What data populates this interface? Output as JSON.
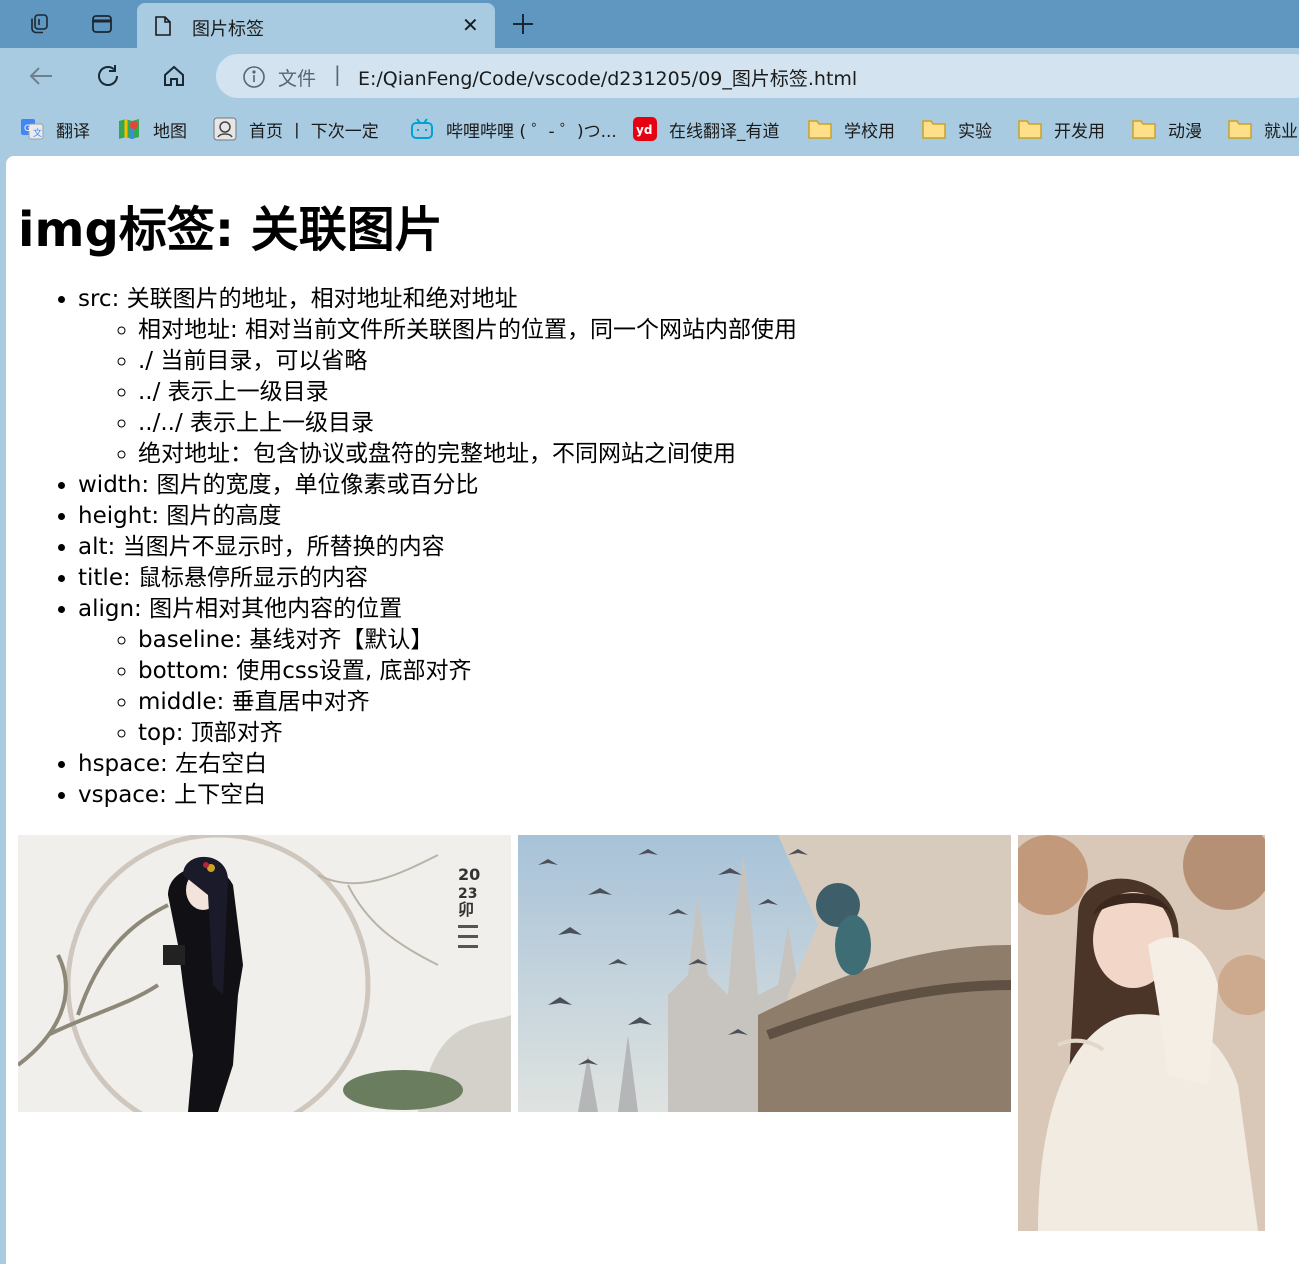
{
  "tab": {
    "title": "图片标签"
  },
  "address": {
    "scheme": "文件",
    "url": "E:/QianFeng/Code/vscode/d231205/09_图片标签.html"
  },
  "bookmarks": [
    {
      "label": "翻译",
      "icon": "google-translate-icon"
    },
    {
      "label": "地图",
      "icon": "maps-icon"
    },
    {
      "label": "首页 丨 下次一定",
      "icon": "avatar-icon"
    },
    {
      "label": "哔哩哔哩 ( ゜- ゜)つ...",
      "icon": "bilibili-icon"
    },
    {
      "label": "在线翻译_有道",
      "icon": "youdao-icon"
    },
    {
      "label": "学校用",
      "icon": "folder-icon"
    },
    {
      "label": "实验",
      "icon": "folder-icon"
    },
    {
      "label": "开发用",
      "icon": "folder-icon"
    },
    {
      "label": "动漫",
      "icon": "folder-icon"
    },
    {
      "label": "就业",
      "icon": "folder-icon"
    }
  ],
  "page": {
    "heading": "img标签: 关联图片",
    "items": {
      "src": "src: 关联图片的地址，相对地址和绝对地址",
      "src_sub": [
        "相对地址: 相对当前文件所关联图片的位置，同一个网站内部使用",
        "./ 当前目录，可以省略",
        "../ 表示上一级目录",
        "../../ 表示上上一级目录",
        "绝对地址：包含协议或盘符的完整地址，不同网站之间使用"
      ],
      "width": "width: 图片的宽度，单位像素或百分比",
      "height": "height: 图片的高度",
      "alt": "alt: 当图片不显示时，所替换的内容",
      "title": "title: 鼠标悬停所显示的内容",
      "align": "align: 图片相对其他内容的位置",
      "align_sub": [
        "baseline: 基线对齐【默认】",
        "bottom: 使用css设置, 底部对齐",
        "middle: 垂直居中对齐",
        "top: 顶部对齐"
      ],
      "hspace": "hspace: 左右空白",
      "vspace": "vspace: 上下空白"
    }
  },
  "colors": {
    "tabstrip": "#5f97c0",
    "toolbar": "#a9cbe1",
    "page": "#ffffff"
  }
}
